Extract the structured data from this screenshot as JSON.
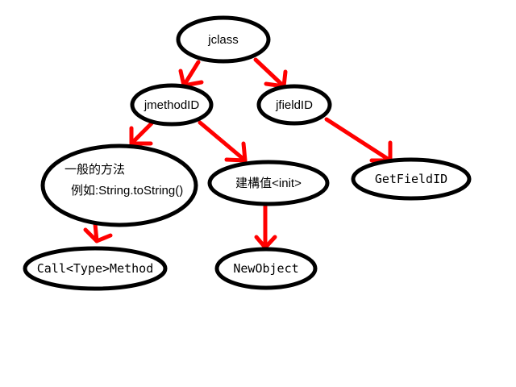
{
  "nodes": {
    "jclass": {
      "label": "jclass"
    },
    "jmethodID": {
      "label": "jmethodID"
    },
    "jfieldID": {
      "label": "jfieldID"
    },
    "general_method": {
      "line1": "一般的方法",
      "line2": "例如:String.toString()"
    },
    "constructor": {
      "label": "建構值<init>"
    },
    "get_field_id": {
      "label": "GetFieldID"
    },
    "call_method": {
      "label": "Call<Type>Method"
    },
    "new_object": {
      "label": "NewObject"
    }
  },
  "edges": [
    {
      "from": "jclass",
      "to": "jmethodID"
    },
    {
      "from": "jclass",
      "to": "jfieldID"
    },
    {
      "from": "jmethodID",
      "to": "general_method"
    },
    {
      "from": "jmethodID",
      "to": "constructor"
    },
    {
      "from": "jfieldID",
      "to": "get_field_id"
    },
    {
      "from": "general_method",
      "to": "call_method"
    },
    {
      "from": "constructor",
      "to": "new_object"
    }
  ],
  "colors": {
    "arrow": "#ff0000",
    "node_border": "#000000",
    "background": "#ffffff"
  }
}
